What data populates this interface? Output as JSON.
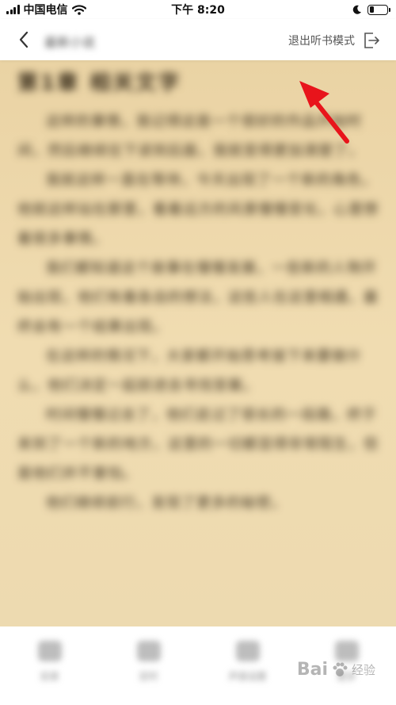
{
  "status_bar": {
    "carrier": "中国电信",
    "time": "下午 8:20",
    "battery_level": 0.25
  },
  "nav": {
    "book_title": "最新小说",
    "exit_listen_label": "退出听书模式"
  },
  "content": {
    "chapter_title": "第1章 相关文字",
    "paragraphs": [
      "这样的事情，我记得这是一个很好的作品开始时间，然后继续往下读到后面，我就变得更加清楚了。",
      "我就这样一直在等待，今天出现了一个新的角色，他就这样站在那里，看着远方的风景慢慢变化，心里想着很多事情。",
      "我们都知道这个故事在慢慢发展，一些新的人物开始出现，他们有着各自的想法，这些人在这里相遇，最终会有一个结果出现。",
      "在这样的情况下，大家都开始思考接下来要做什么，他们决定一起前进去寻找答案。",
      "时间慢慢过去了，他们走过了很长的一段路，终于来到了一个新的地方，这里的一切都显得非常陌生，但是他们并不害怕。",
      "他们继续前行，发现了更多的秘密。"
    ]
  },
  "toolbar": {
    "items": [
      {
        "label": "目录"
      },
      {
        "label": "定时"
      },
      {
        "label": "声音设置"
      },
      {
        "label": "更多"
      }
    ]
  },
  "watermark": {
    "brand": "Bai",
    "brand_suffix": "经验"
  },
  "colors": {
    "page_bg": "#ead3a4",
    "arrow": "#e8141b"
  }
}
